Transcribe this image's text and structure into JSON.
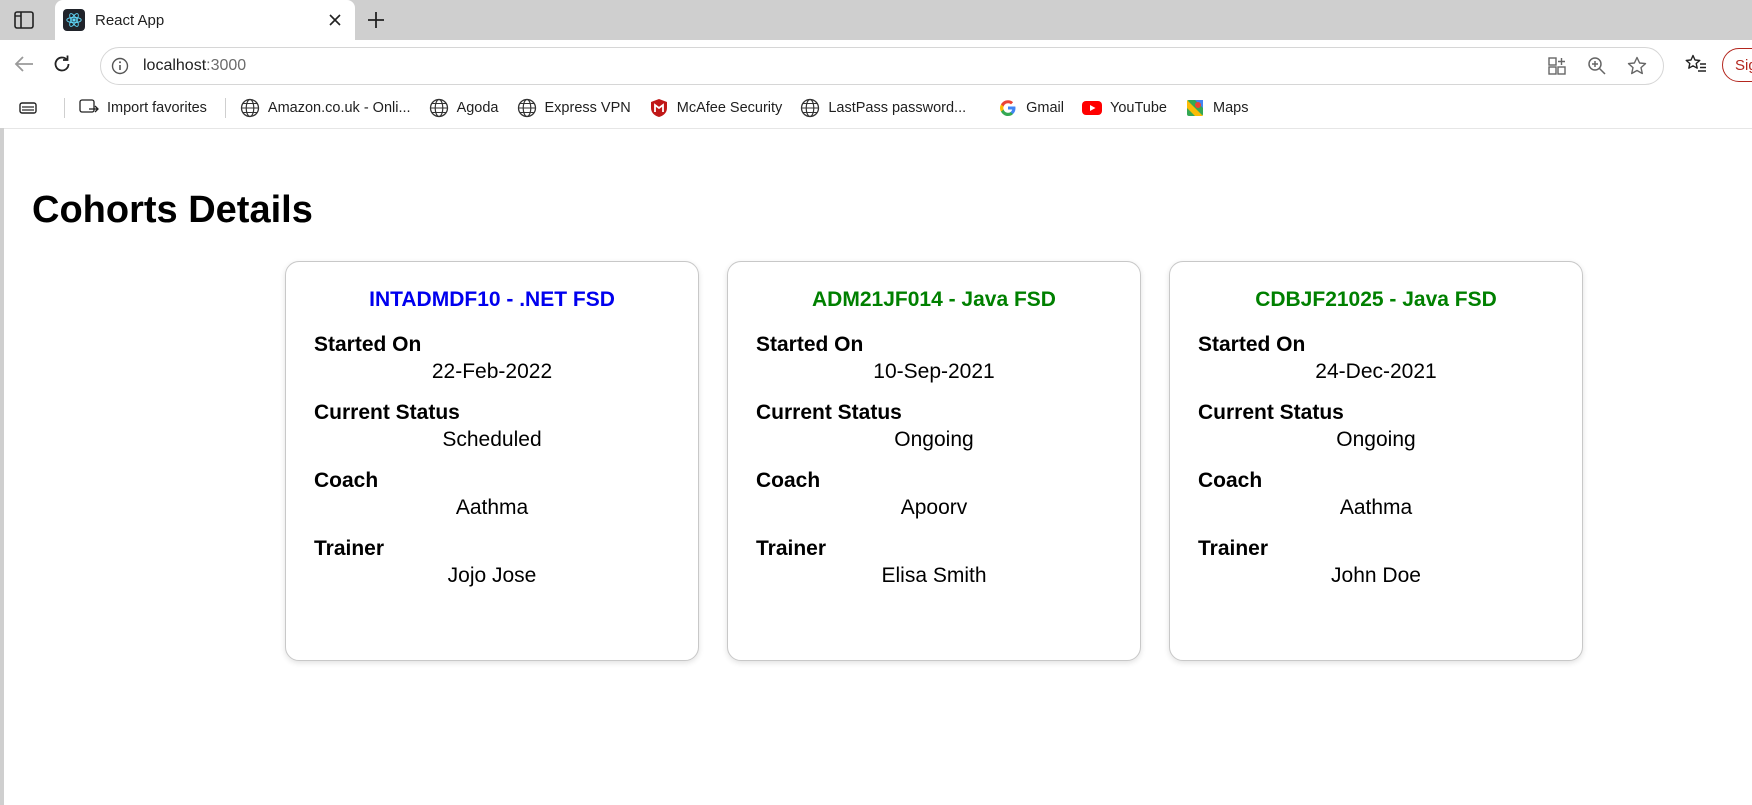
{
  "browser": {
    "tab": {
      "title": "React App"
    },
    "address": {
      "host": "localhost",
      "port": ":3000"
    },
    "signin_label": "Sig",
    "bookmarks": [
      {
        "label": "Import favorites",
        "icon": "import-icon"
      },
      {
        "label": "Amazon.co.uk - Onli...",
        "icon": "globe-icon"
      },
      {
        "label": "Agoda",
        "icon": "globe-icon"
      },
      {
        "label": "Express VPN",
        "icon": "globe-icon"
      },
      {
        "label": "McAfee Security",
        "icon": "mcafee-icon"
      },
      {
        "label": "LastPass password...",
        "icon": "globe-icon"
      },
      {
        "label": "Gmail",
        "icon": "google-icon"
      },
      {
        "label": "YouTube",
        "icon": "youtube-icon"
      },
      {
        "label": "Maps",
        "icon": "maps-icon"
      }
    ]
  },
  "page": {
    "title": "Cohorts Details",
    "labels": {
      "started_on": "Started On",
      "current_status": "Current Status",
      "coach": "Coach",
      "trainer": "Trainer"
    },
    "cohorts": [
      {
        "title": "INTADMDF10 - .NET FSD",
        "title_color": "#0000ee",
        "started_on": "22-Feb-2022",
        "status": "Scheduled",
        "coach": "Aathma",
        "trainer": "Jojo Jose"
      },
      {
        "title": "ADM21JF014 - Java FSD",
        "title_color": "#008000",
        "started_on": "10-Sep-2021",
        "status": "Ongoing",
        "coach": "Apoorv",
        "trainer": "Elisa Smith"
      },
      {
        "title": "CDBJF21025 - Java FSD",
        "title_color": "#008000",
        "started_on": "24-Dec-2021",
        "status": "Ongoing",
        "coach": "Aathma",
        "trainer": "John Doe"
      }
    ]
  }
}
